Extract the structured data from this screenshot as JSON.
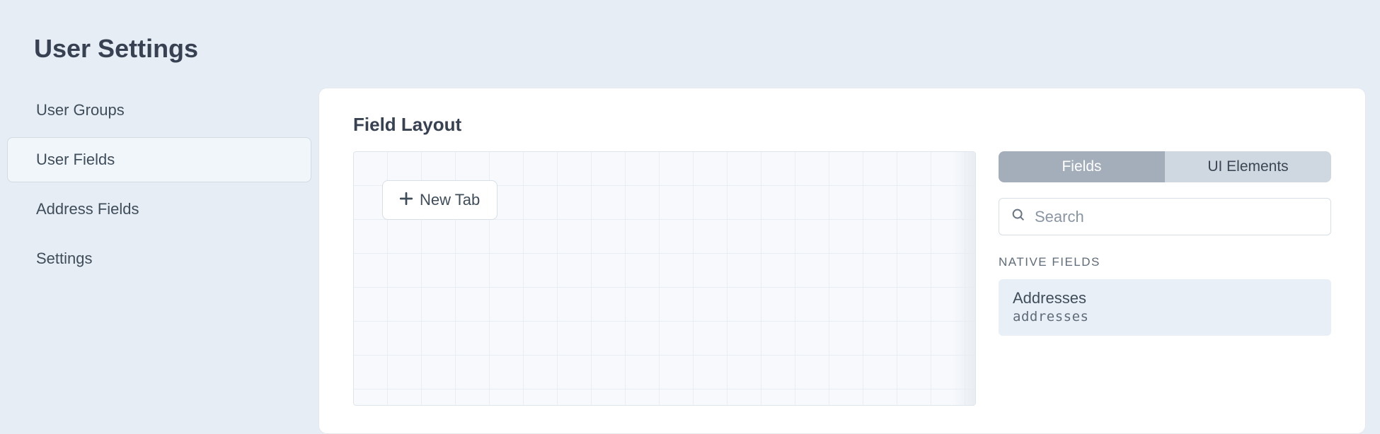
{
  "page": {
    "title": "User Settings"
  },
  "sidebar": {
    "items": [
      {
        "label": "User Groups",
        "active": false
      },
      {
        "label": "User Fields",
        "active": true
      },
      {
        "label": "Address Fields",
        "active": false
      },
      {
        "label": "Settings",
        "active": false
      }
    ]
  },
  "main": {
    "section_title": "Field Layout",
    "new_tab_label": "New Tab"
  },
  "right_panel": {
    "tabs": {
      "fields": "Fields",
      "ui_elements": "UI Elements"
    },
    "search_placeholder": "Search",
    "native_fields_label": "NATIVE FIELDS",
    "native_fields": [
      {
        "title": "Addresses",
        "handle": "addresses"
      }
    ]
  }
}
